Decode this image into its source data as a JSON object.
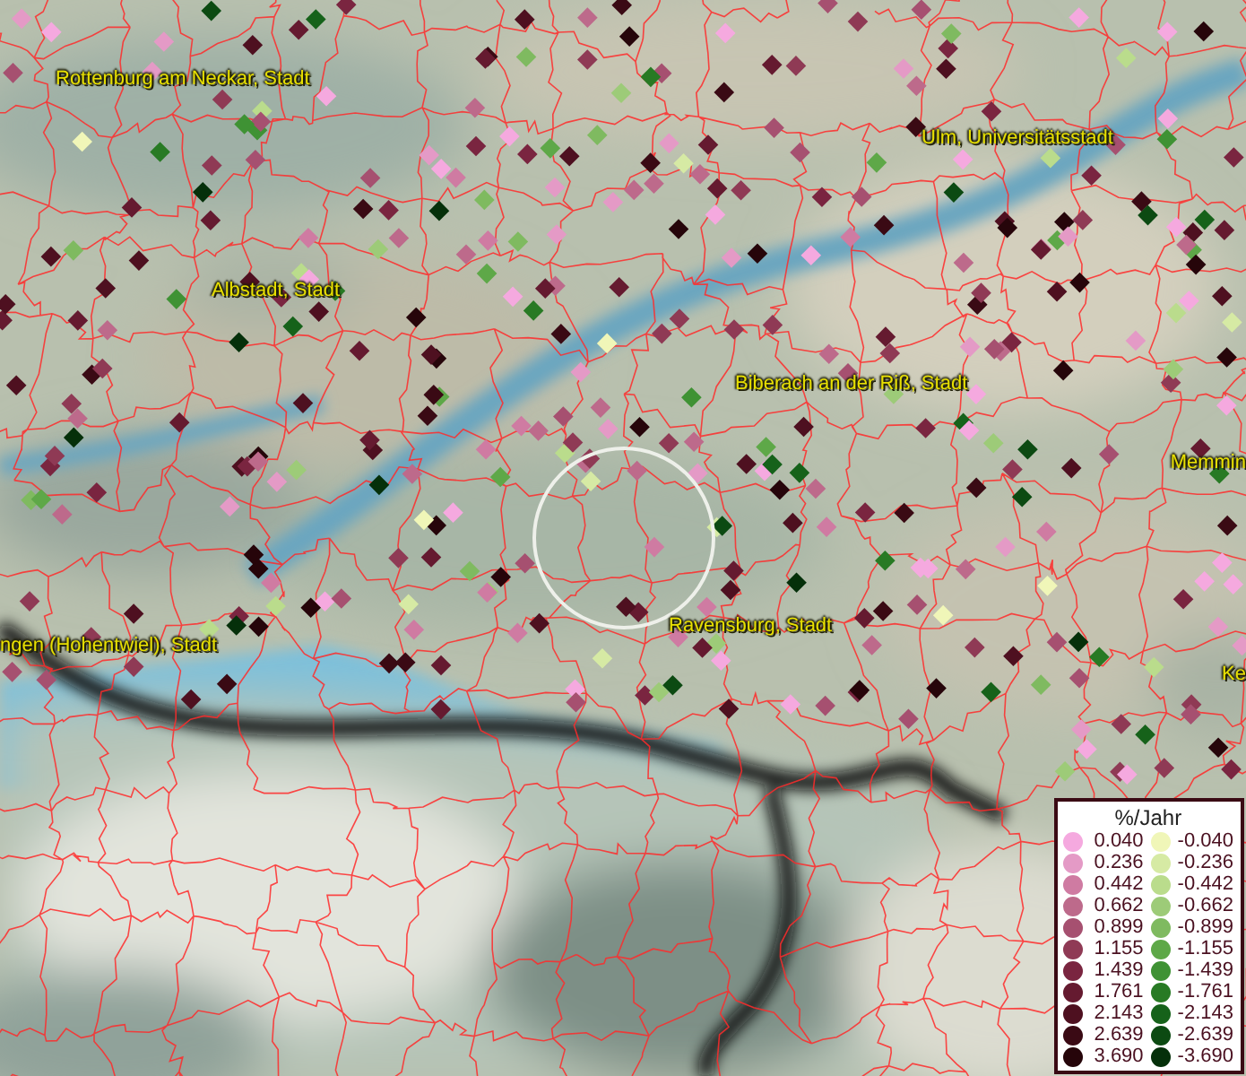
{
  "map": {
    "labels": [
      {
        "text": "Rottenburg am Neckar, Stadt"
      },
      {
        "text": "Ulm, Universitätsstadt"
      },
      {
        "text": "Albstadt, Stadt"
      },
      {
        "text": "Biberach an der Riß, Stadt"
      },
      {
        "text": "Memmin"
      },
      {
        "text": "ngen (Hohentwiel), Stadt"
      },
      {
        "text": "Ravensburg, Stadt"
      },
      {
        "text": "Ke"
      }
    ]
  },
  "legend": {
    "title": "%/Jahr",
    "items": [
      {
        "value": "0.040",
        "color": "#f5a9df"
      },
      {
        "value": "-0.040",
        "color": "#f0f6b8"
      },
      {
        "value": "0.236",
        "color": "#e49ac6"
      },
      {
        "value": "-0.236",
        "color": "#d6eaa4"
      },
      {
        "value": "0.442",
        "color": "#cf7ba2"
      },
      {
        "value": "-0.442",
        "color": "#badc8c"
      },
      {
        "value": "0.662",
        "color": "#bd6a8b"
      },
      {
        "value": "-0.662",
        "color": "#9dcb78"
      },
      {
        "value": "0.899",
        "color": "#a65070"
      },
      {
        "value": "-0.899",
        "color": "#7fba60"
      },
      {
        "value": "1.155",
        "color": "#8f3a55"
      },
      {
        "value": "-1.155",
        "color": "#5ea848"
      },
      {
        "value": "1.439",
        "color": "#7a2540"
      },
      {
        "value": "-1.439",
        "color": "#3f9234"
      },
      {
        "value": "1.761",
        "color": "#651a30"
      },
      {
        "value": "-1.761",
        "color": "#287a24"
      },
      {
        "value": "2.143",
        "color": "#4e1020"
      },
      {
        "value": "-2.143",
        "color": "#16621a"
      },
      {
        "value": "2.639",
        "color": "#3a0a14"
      },
      {
        "value": "-2.639",
        "color": "#0c4a12"
      },
      {
        "value": "3.690",
        "color": "#26050a"
      },
      {
        "value": "-3.690",
        "color": "#05300a"
      }
    ]
  }
}
